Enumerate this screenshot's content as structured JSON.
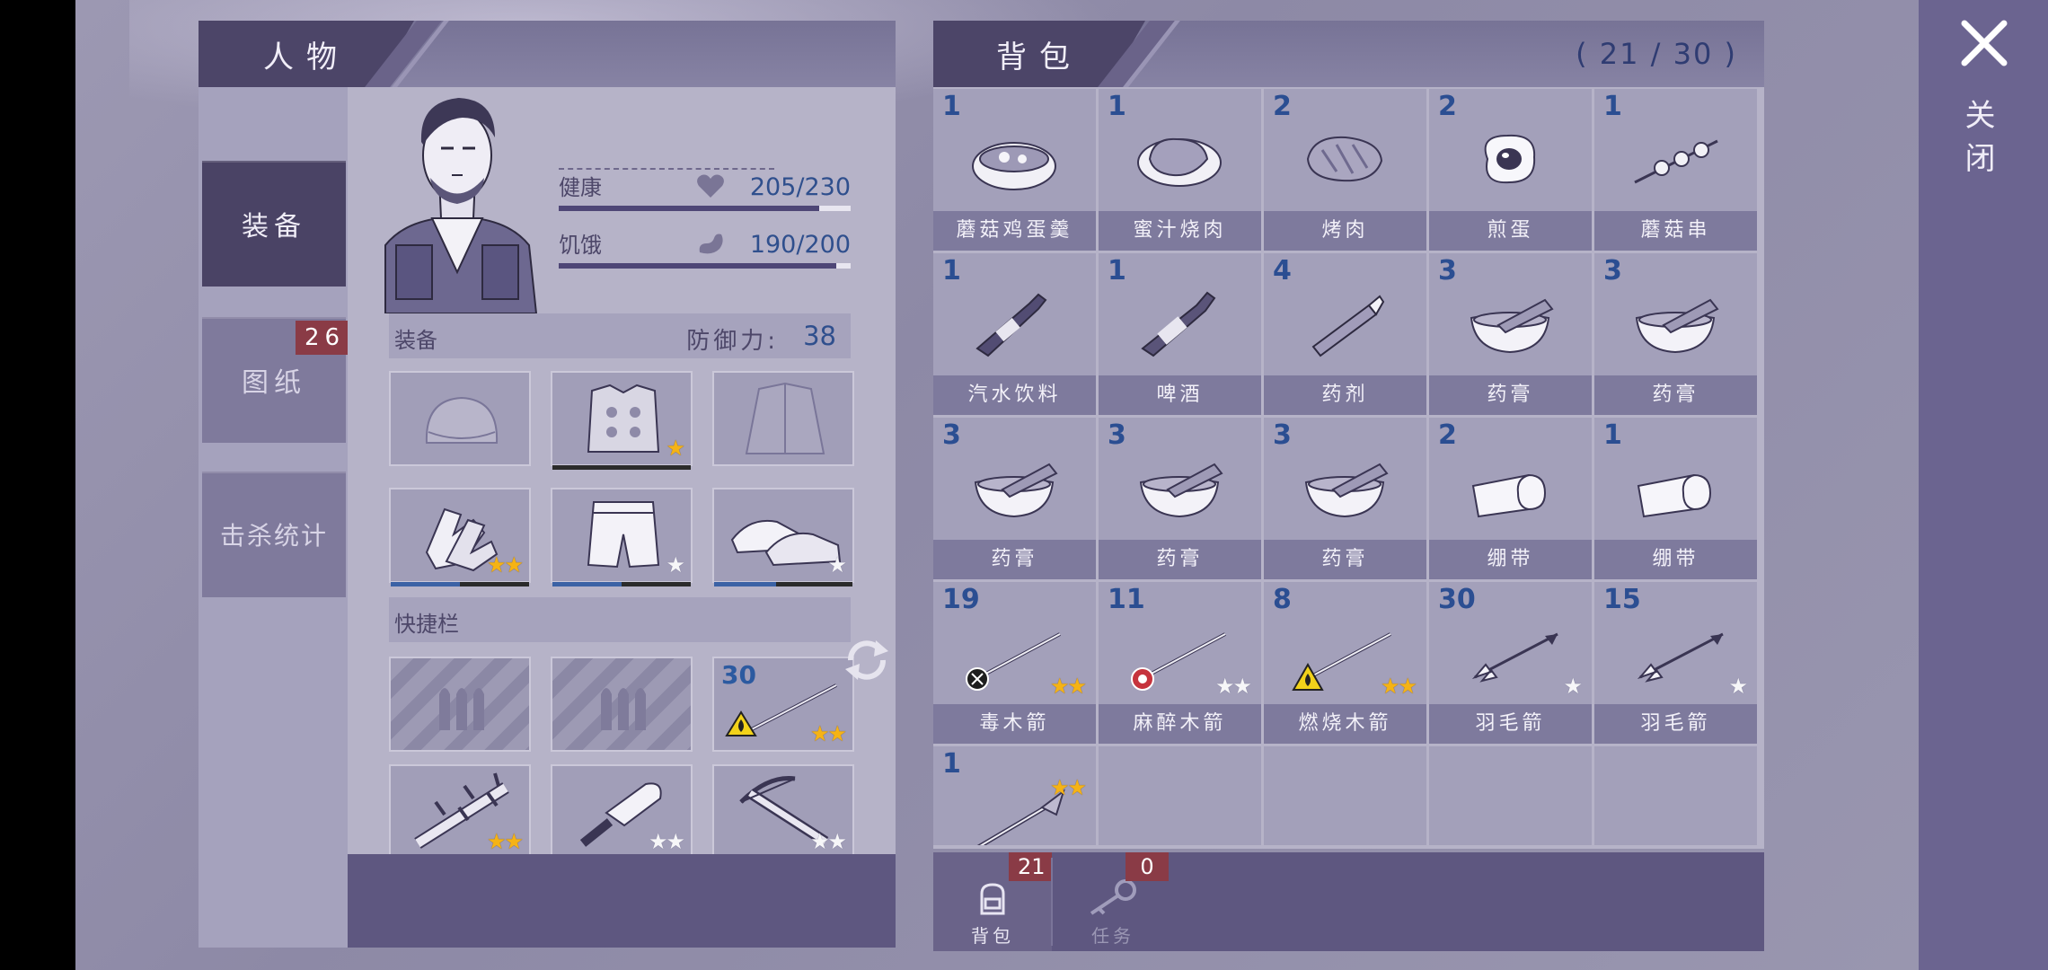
{
  "character_panel": {
    "title": "人物",
    "sidebar": [
      {
        "label": "装备",
        "active": true
      },
      {
        "label": "图纸",
        "badge": "26"
      },
      {
        "label": "击杀统计"
      }
    ],
    "stats": [
      {
        "label": "健康",
        "value": "205/230",
        "fraction": 0.891,
        "icon": "heart-icon"
      },
      {
        "label": "饥饿",
        "value": "190/200",
        "fraction": 0.95,
        "icon": "stomach-icon"
      }
    ],
    "equipment_section": {
      "label": "装备",
      "defense_label": "防御力:",
      "defense_value": "38"
    },
    "equipment_slots": [
      {
        "item": "knit-cap",
        "stars": 0,
        "durability": null
      },
      {
        "item": "armor-vest",
        "stars": 1,
        "star_color": "gold",
        "durability": 0
      },
      {
        "item": "jacket",
        "stars": 0,
        "durability": null
      },
      {
        "item": "gloves",
        "stars": 2,
        "star_color": "gold",
        "durability": 0.5
      },
      {
        "item": "shorts",
        "stars": 1,
        "star_color": "white",
        "durability": 0.5
      },
      {
        "item": "shoes",
        "stars": 1,
        "star_color": "white",
        "durability": 0.45
      }
    ],
    "quickbar_section": {
      "label": "快捷栏"
    },
    "quickbar_slots": [
      {
        "item": "empty-ammo"
      },
      {
        "item": "empty-ammo"
      },
      {
        "item": "incendiary-bolt",
        "qty": "30",
        "stars": 2,
        "star_color": "gold",
        "swap_icon": "refresh-icon"
      },
      {
        "item": "spiked-club",
        "stars": 2,
        "star_color": "gold",
        "durability": 0.5
      },
      {
        "item": "cleaver",
        "stars": 2,
        "star_color": "white",
        "durability": 0.45
      },
      {
        "item": "crossbow",
        "stars": 2,
        "star_color": "white",
        "durability": 1.0
      }
    ]
  },
  "backpack_panel": {
    "title": "背包",
    "count": "( 21 / 30 )",
    "items": [
      {
        "num": "1",
        "name": "蘑菇鸡蛋羹",
        "icon": "bowl-soup-icon"
      },
      {
        "num": "1",
        "name": "蜜汁烧肉",
        "icon": "roast-meat-icon"
      },
      {
        "num": "2",
        "name": "烤肉",
        "icon": "grilled-steak-icon"
      },
      {
        "num": "2",
        "name": "煎蛋",
        "icon": "fried-egg-icon"
      },
      {
        "num": "1",
        "name": "蘑菇串",
        "icon": "mushroom-skewer-icon"
      },
      {
        "num": "1",
        "name": "汽水饮料",
        "icon": "soda-bottle-icon"
      },
      {
        "num": "1",
        "name": "啤酒",
        "icon": "beer-bottle-icon"
      },
      {
        "num": "4",
        "name": "药剂",
        "icon": "medicine-tube-icon"
      },
      {
        "num": "3",
        "name": "药膏",
        "icon": "mortar-icon"
      },
      {
        "num": "3",
        "name": "药膏",
        "icon": "mortar-icon"
      },
      {
        "num": "3",
        "name": "药膏",
        "icon": "mortar-icon"
      },
      {
        "num": "3",
        "name": "药膏",
        "icon": "mortar-icon"
      },
      {
        "num": "3",
        "name": "药膏",
        "icon": "mortar-icon"
      },
      {
        "num": "2",
        "name": "绷带",
        "icon": "bandage-icon"
      },
      {
        "num": "1",
        "name": "绷带",
        "icon": "bandage-icon"
      },
      {
        "num": "19",
        "name": "毒木箭",
        "icon": "poison-bolt-icon",
        "stars": 2,
        "star_color": "gold"
      },
      {
        "num": "11",
        "name": "麻醉木箭",
        "icon": "tranquilizer-bolt-icon",
        "stars": 2,
        "star_color": "white"
      },
      {
        "num": "8",
        "name": "燃烧木箭",
        "icon": "fire-bolt-icon",
        "stars": 2,
        "star_color": "gold"
      },
      {
        "num": "30",
        "name": "羽毛箭",
        "icon": "feather-arrow-icon",
        "stars": 1,
        "star_color": "white"
      },
      {
        "num": "15",
        "name": "羽毛箭",
        "icon": "feather-arrow-icon",
        "stars": 1,
        "star_color": "white"
      },
      {
        "num": "1",
        "name": "",
        "icon": "spear-icon",
        "stars": 2,
        "star_color": "gold"
      }
    ],
    "footer_tabs": [
      {
        "label": "背包",
        "badge": "21",
        "icon": "backpack-icon",
        "active": true
      },
      {
        "label": "任务",
        "badge": "0",
        "icon": "key-icon",
        "active": false
      }
    ]
  },
  "close": {
    "label": "关闭",
    "icon": "close-icon"
  },
  "colors": {
    "accent_blue": "#2b4e92",
    "badge_red": "#8a3b46",
    "star_gold": "#f5b315",
    "panel_dark": "#4c4568"
  }
}
